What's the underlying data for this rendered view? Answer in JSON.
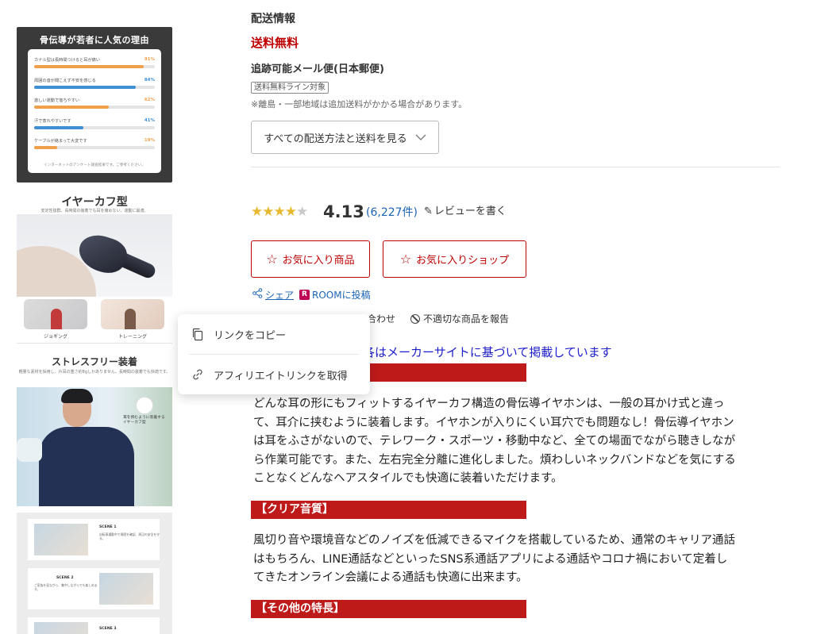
{
  "gallery": {
    "survey_title": "骨伝導が若者に人気の理由",
    "survey": [
      {
        "label": "カナル型は長時間つけると耳が痛い",
        "pct": "91%",
        "fill": 0.91,
        "color": "#f0a04b"
      },
      {
        "label": "周囲の音が聞こえず不安を感じる",
        "pct": "84%",
        "fill": 0.84,
        "color": "#3e8fd4"
      },
      {
        "label": "激しい運動で落ちやすい",
        "pct": "62%",
        "fill": 0.62,
        "color": "#f0a04b"
      },
      {
        "label": "汗で蒸れやすいです",
        "pct": "41%",
        "fill": 0.41,
        "color": "#3e8fd4"
      },
      {
        "label": "ケーブルが絡まって大変です",
        "pct": "19%",
        "fill": 0.19,
        "color": "#f0a04b"
      }
    ],
    "survey_note": "インターネットのアンケート調査結果です。ご参考ください。",
    "earcuff_title": "イヤーカフ型",
    "earcuff_sub": "安定性抜群、長時間の装着でも耳を痛めない、運動に最適。",
    "scene_jogging": "ジョギング",
    "scene_training": "トレーニング",
    "stressfree_title": "ストレスフリー装着",
    "stressfree_sub": "軽量な素材を採用し、片耳の重さ約8gしかありません。長時間の装着でも快適です。",
    "stressfree_caption": "耳を挟むように装着するイヤーカフ型",
    "scene1_title": "SCENE 1",
    "scene1_text": "自転車通勤中で周囲を確認、周辺の安全を守る。",
    "scene2_title": "SCENE 2",
    "scene2_text": "ご家族を見ながら、集中しながらでも楽しめます。",
    "scene3_title": "SCENE 3"
  },
  "shipping": {
    "heading": "配送情報",
    "free": "送料無料",
    "method": "追跡可能メール便(日本郵便)",
    "tag": "送料無料ライン対象",
    "note": "※離島・一部地域は追加送料がかかる場合があります。",
    "all_methods_button": "すべての配送方法と送料を見る"
  },
  "review": {
    "rating": 4.13,
    "rating_text": "4.13",
    "count_text": "(6,227件)",
    "write_label": "レビューを書く"
  },
  "actions": {
    "favorite_item": "お気に入り商品",
    "favorite_shop": "お気に入りショップ",
    "share": "シェア",
    "room_post": "ROOMに投稿",
    "inquiry": "合わせ",
    "report": "不適切な商品を報告"
  },
  "share_menu": {
    "copy_link": "リンクをコピー",
    "affiliate_link": "アフィリエイトリンクを取得"
  },
  "description": {
    "maker_note": "各はメーカーサイトに基づいて掲載しています",
    "para1_lines": [
      "どんな耳の形にもフィットするイヤーカフ構造の骨伝導イヤホンは、一般の耳かけ式と違っ",
      "て、耳介に挟むように装着します。イヤホンが入りにくい耳穴でも問題なし！骨伝導イヤホン",
      "は耳をふさがないので、テレワーク・スポーツ・移動中など、全ての場面でながら聴きしなが",
      "ら作業可能です。また、左右完全分離に進化しました。煩わしいネックバンドなどを気にする",
      "ことなくどんなヘアスタイルでも快適に装着いただけます。"
    ],
    "section2_title": "【クリア音質】",
    "para2_lines": [
      "風切り音や環境音などのノイズを低減できるマイクを搭載しているため、通常のキャリア通話",
      "はもちろん、LINE通話などといったSNS系通話アプリによる通話やコロナ禍において定着し",
      "てきたオンライン会議による通話も快適に出来ます。"
    ],
    "section3_title": "【その他の特長】"
  },
  "colors": {
    "accent_red": "#bf0000",
    "section_red": "#bf1a1a",
    "link_blue": "#1b64b7",
    "star_gold": "#e8b92e"
  }
}
